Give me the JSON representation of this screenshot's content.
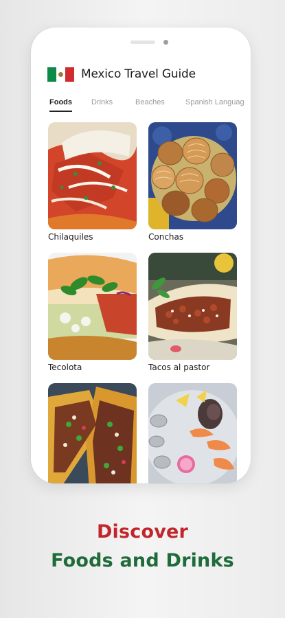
{
  "app": {
    "title": "Mexico Travel Guide",
    "flag_icon": "mexico-flag-icon"
  },
  "tabs": [
    {
      "label": "Foods",
      "active": true
    },
    {
      "label": "Drinks",
      "active": false
    },
    {
      "label": "Beaches",
      "active": false
    },
    {
      "label": "Spanish Languag",
      "active": false
    }
  ],
  "foods": [
    {
      "name": "Chilaquiles",
      "image": "chilaquiles-image"
    },
    {
      "name": "Conchas",
      "image": "conchas-image"
    },
    {
      "name": "Tecolota",
      "image": "tecolota-image"
    },
    {
      "name": "Tacos al pastor",
      "image": "tacos-al-pastor-image"
    },
    {
      "name": "",
      "image": "tacos-image"
    },
    {
      "name": "",
      "image": "seafood-platter-image"
    }
  ],
  "promo": {
    "line1": "Discover",
    "line2": "Foods and Drinks"
  },
  "colors": {
    "promo_red": "#c0262c",
    "promo_green": "#1f6b39",
    "flag_green": "#0b8a48",
    "flag_red": "#d12b2f"
  }
}
